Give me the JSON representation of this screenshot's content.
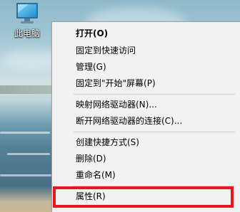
{
  "desktop": {
    "icon_name": "monitor-icon",
    "icon_label": "此电脑"
  },
  "context_menu": {
    "items": [
      {
        "label": "打开(O)",
        "bold": true
      },
      {
        "label": "固定到快速访问"
      },
      {
        "label": "管理(G)"
      },
      {
        "label": "固定到\"开始\"屏幕(P)"
      },
      {
        "label": "映射网络驱动器(N)..."
      },
      {
        "label": "断开网络驱动器的连接(C)..."
      },
      {
        "label": "创建快捷方式(S)"
      },
      {
        "label": "删除(D)"
      },
      {
        "label": "重命名(M)"
      },
      {
        "label": "属性(R)"
      }
    ],
    "highlighted_item": "属性(R)"
  },
  "colors": {
    "menu_background": "#f2f2f2",
    "highlight_border": "#e8161f",
    "separator": "#cfcfcf"
  }
}
